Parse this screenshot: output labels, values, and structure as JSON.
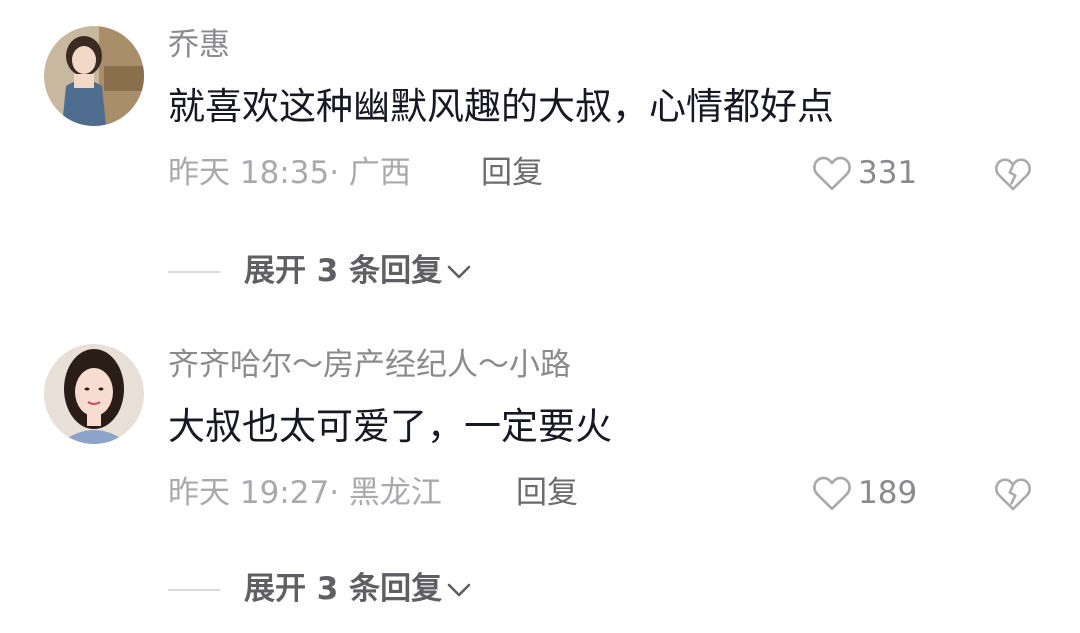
{
  "comments": [
    {
      "username": "乔惠",
      "text": "就喜欢这种幽默风趣的大叔，心情都好点",
      "time": "昨天 18:35",
      "location": "· 广西",
      "reply_label": "回复",
      "likes": "331",
      "expand_label": "展开 3 条回复",
      "avatar_icon": "user-photo"
    },
    {
      "username": "齐齐哈尔～房产经纪人～小路",
      "text": "大叔也太可爱了，一定要火",
      "time": "昨天 19:27",
      "location": "· 黑龙江",
      "reply_label": "回复",
      "likes": "189",
      "expand_label": "展开 3 条回复",
      "avatar_icon": "user-photo"
    }
  ],
  "icons": {
    "like": "heart-outline-icon",
    "dislike": "broken-heart-icon",
    "expand": "chevron-down-icon"
  },
  "colors": {
    "text_primary": "#161823",
    "text_secondary": "#8a8a8f",
    "text_muted": "#a9a9ae",
    "background": "#ffffff"
  }
}
